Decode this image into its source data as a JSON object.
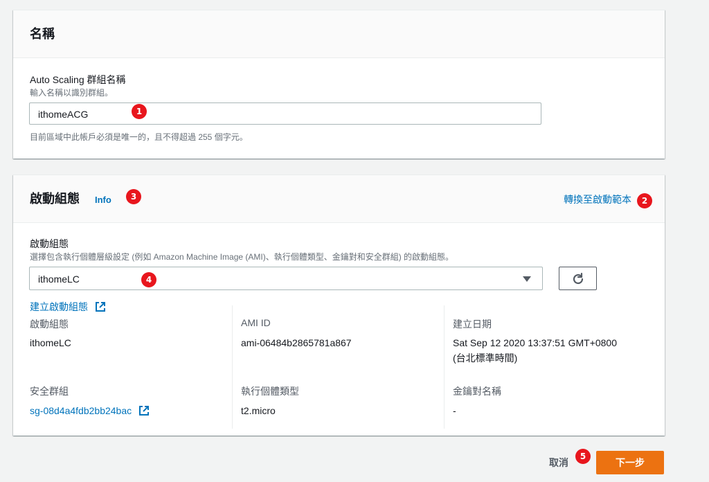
{
  "name_panel": {
    "title": "名稱",
    "field_label": "Auto Scaling 群組名稱",
    "field_desc": "輸入名稱以識別群組。",
    "value": "ithomeACG",
    "constraint": "目前區域中此帳戶必須是唯一的，且不得超過 255 個字元。"
  },
  "lc_panel": {
    "title": "啟動組態",
    "info": "Info",
    "switch_link": "轉換至啟動範本",
    "field_label": "啟動組態",
    "field_desc": "選擇包含執行個體層級設定 (例如 Amazon Machine Image (AMI)、執行個體類型、金鑰對和安全群組) 的啟動組態。",
    "selected": "ithomeLC",
    "create_link": "建立啟動組態",
    "details": {
      "lc_key": "啟動組態",
      "lc_val": "ithomeLC",
      "ami_key": "AMI ID",
      "ami_val": "ami-06484b2865781a867",
      "date_key": "建立日期",
      "date_val_line1": "Sat Sep 12 2020 13:37:51 GMT+0800",
      "date_val_line2": "(台北標準時間)",
      "sg_key": "安全群組",
      "sg_val": "sg-08d4a4fdb2bb24bac",
      "type_key": "執行個體類型",
      "type_val": "t2.micro",
      "key_key": "金鑰對名稱",
      "key_val": "-"
    }
  },
  "footer": {
    "cancel": "取消",
    "next": "下一步"
  },
  "badges": [
    "1",
    "2",
    "3",
    "4",
    "5"
  ],
  "colors": {
    "link": "#0073bb",
    "primary_button": "#ec7211",
    "badge": "#e8161d",
    "background": "#f2f3f3"
  }
}
